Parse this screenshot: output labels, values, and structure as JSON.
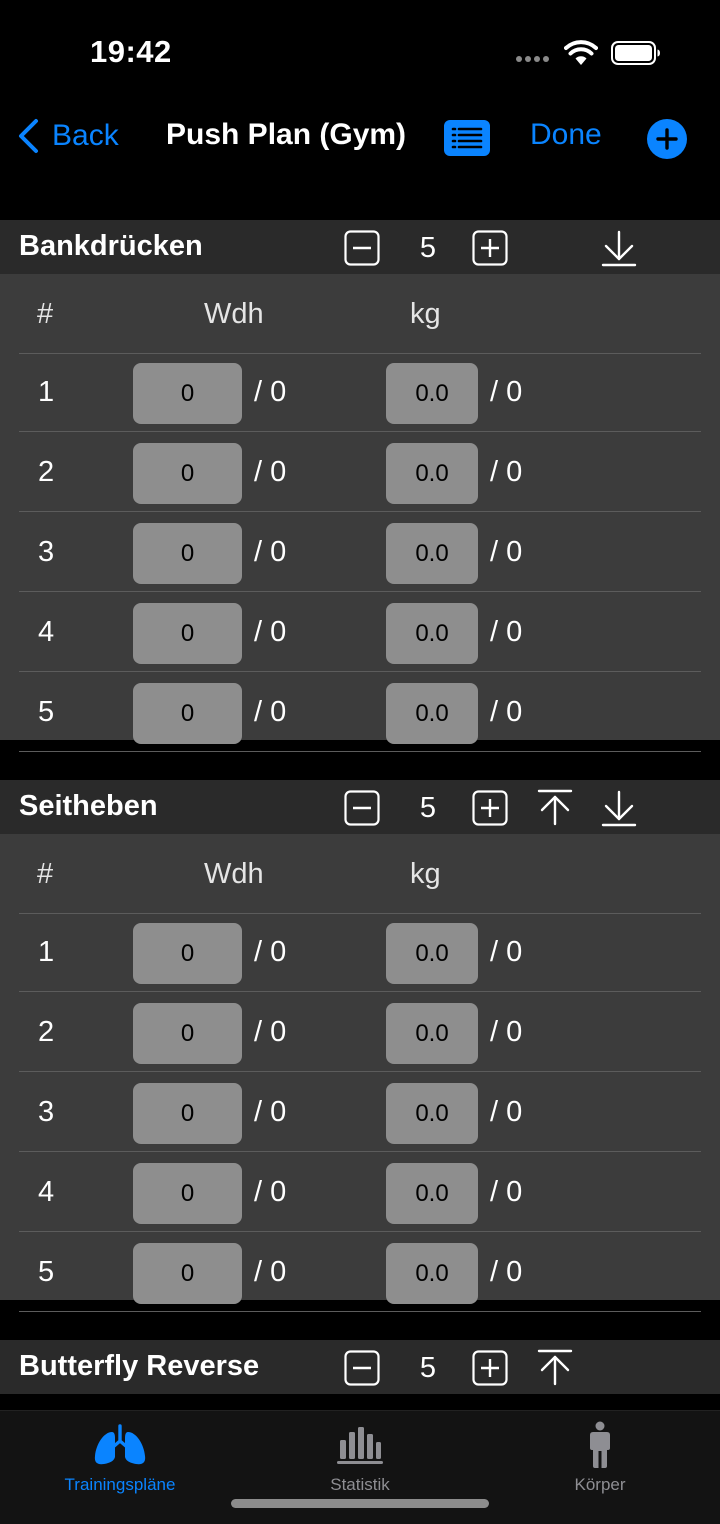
{
  "status_bar": {
    "time": "19:42"
  },
  "nav": {
    "back_label": "Back",
    "title": "Push Plan (Gym)",
    "done_label": "Done"
  },
  "columns": {
    "num": "#",
    "reps": "Wdh",
    "kg": "kg"
  },
  "exercises": [
    {
      "name": "Bankdrücken",
      "sets": "5",
      "rows": [
        {
          "num": "1",
          "reps": "0",
          "reps_target": "/ 0",
          "kg": "0.0",
          "kg_target": "/ 0"
        },
        {
          "num": "2",
          "reps": "0",
          "reps_target": "/ 0",
          "kg": "0.0",
          "kg_target": "/ 0"
        },
        {
          "num": "3",
          "reps": "0",
          "reps_target": "/ 0",
          "kg": "0.0",
          "kg_target": "/ 0"
        },
        {
          "num": "4",
          "reps": "0",
          "reps_target": "/ 0",
          "kg": "0.0",
          "kg_target": "/ 0"
        },
        {
          "num": "5",
          "reps": "0",
          "reps_target": "/ 0",
          "kg": "0.0",
          "kg_target": "/ 0"
        }
      ]
    },
    {
      "name": "Seitheben",
      "sets": "5",
      "rows": [
        {
          "num": "1",
          "reps": "0",
          "reps_target": "/ 0",
          "kg": "0.0",
          "kg_target": "/ 0"
        },
        {
          "num": "2",
          "reps": "0",
          "reps_target": "/ 0",
          "kg": "0.0",
          "kg_target": "/ 0"
        },
        {
          "num": "3",
          "reps": "0",
          "reps_target": "/ 0",
          "kg": "0.0",
          "kg_target": "/ 0"
        },
        {
          "num": "4",
          "reps": "0",
          "reps_target": "/ 0",
          "kg": "0.0",
          "kg_target": "/ 0"
        },
        {
          "num": "5",
          "reps": "0",
          "reps_target": "/ 0",
          "kg": "0.0",
          "kg_target": "/ 0"
        }
      ]
    },
    {
      "name": "Butterfly Reverse",
      "sets": "5"
    }
  ],
  "tabs": [
    {
      "label": "Trainingspläne",
      "icon": "lungs-icon",
      "active": true
    },
    {
      "label": "Statistik",
      "icon": "bar-chart-icon",
      "active": false
    },
    {
      "label": "Körper",
      "icon": "person-icon",
      "active": false
    }
  ],
  "colors": {
    "accent": "#0a84ff",
    "background": "#000000",
    "header_bg": "#2a2a2a",
    "card_bg": "#3c3c3c",
    "field_bg": "#8e8e8e",
    "inactive_tab": "#8e8e93"
  }
}
